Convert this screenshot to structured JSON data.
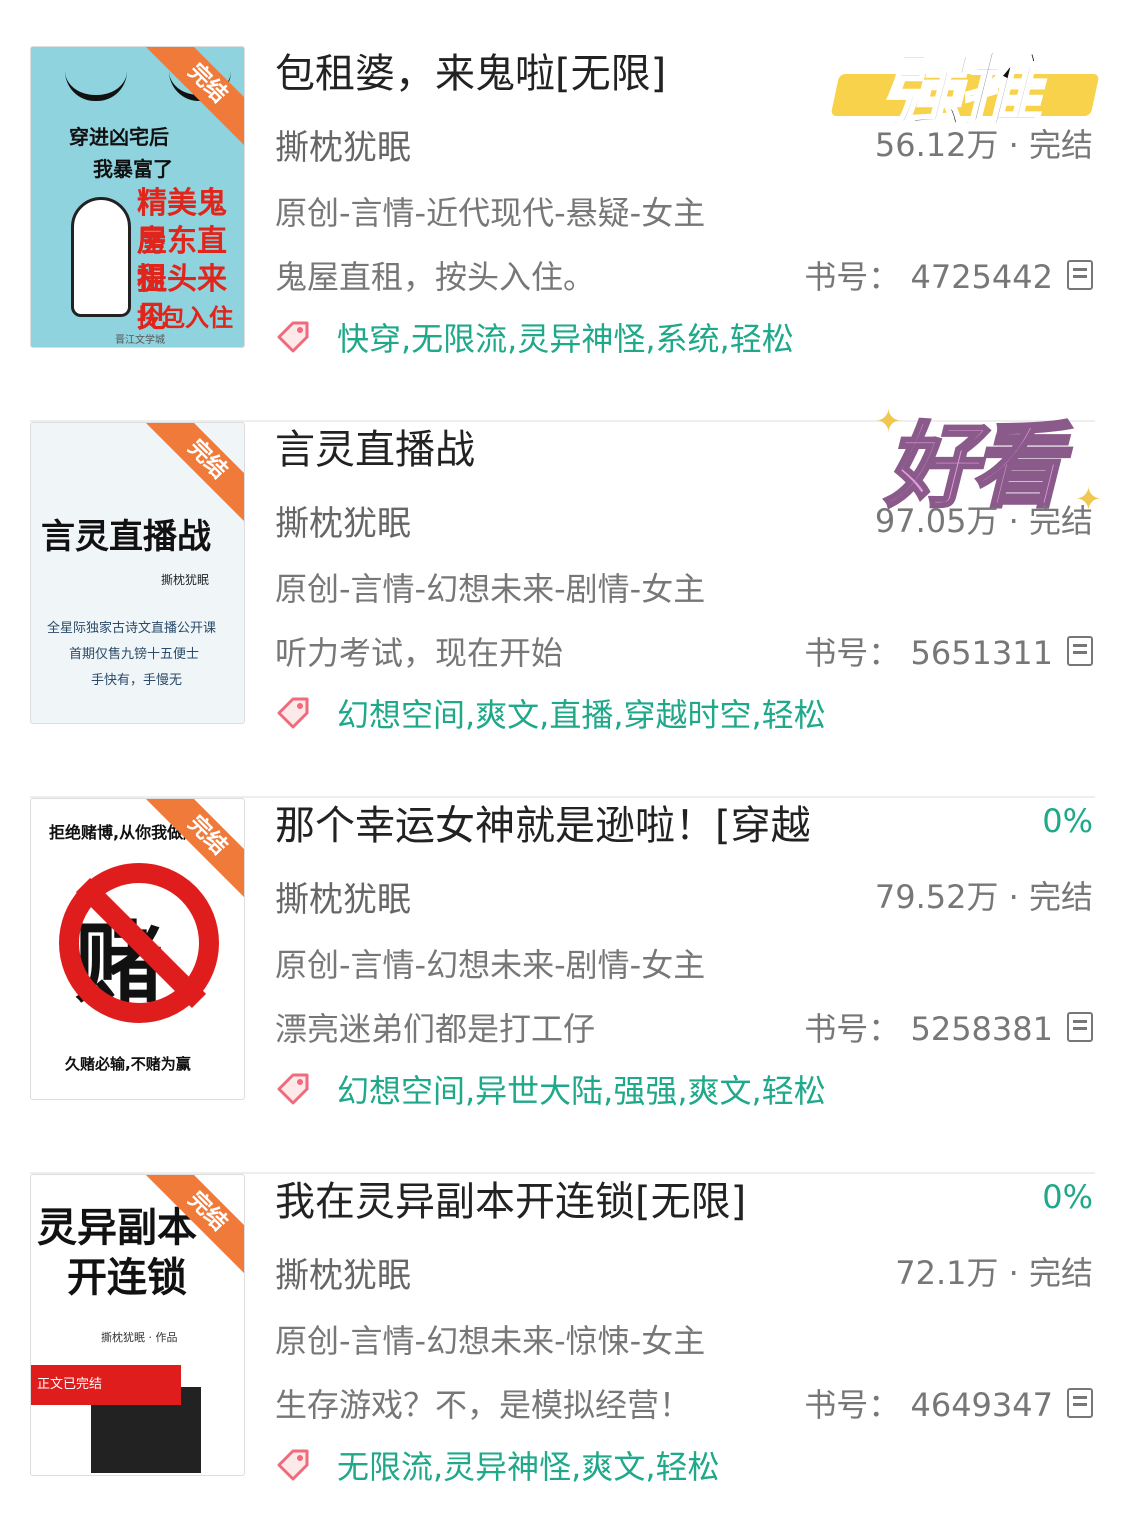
{
  "books": [
    {
      "title": "包租婆，来鬼啦[无限]",
      "author": "撕枕犹眠",
      "stat": "56.12万 · 完结",
      "genre": "原创-言情-近代现代-悬疑-女主",
      "intro": "鬼屋直租，按头入住。",
      "book_id": "书号： 4725442",
      "tags": "快穿,无限流,灵异神怪,系统,轻松",
      "ribbon": "完结",
      "stamp": "强推",
      "cover_text": {
        "line1": "穿进凶宅后",
        "line2": "我暴富了",
        "red1": "精美鬼屋",
        "red2": "房东直租",
        "red3": "提头来见",
        "red4": "拎包入住",
        "brand": "晋江文学城"
      }
    },
    {
      "title": "言灵直播战",
      "author": "撕枕犹眠",
      "stat": "97.05万 · 完结",
      "genre": "原创-言情-幻想未来-剧情-女主",
      "intro": "听力考试，现在开始",
      "book_id": "书号： 5651311",
      "tags": "幻想空间,爽文,直播,穿越时空,轻松",
      "ribbon": "完结",
      "stamp": "好看",
      "cover_text": {
        "big": "言灵直播战",
        "author": "撕枕犹眠",
        "line1": "全星际独家古诗文直播公开课",
        "line2": "首期仅售九镑十五便士",
        "line3": "手快有，手慢无"
      }
    },
    {
      "title": "那个幸运女神就是逊啦！[穿越",
      "author": "撕枕犹眠",
      "stat": "79.52万 · 完结",
      "genre": "原创-言情-幻想未来-剧情-女主",
      "intro": "漂亮迷弟们都是打工仔",
      "book_id": "书号： 5258381",
      "tags": "幻想空间,异世大陆,强强,爽文,轻松",
      "progress": "0%",
      "ribbon": "完结",
      "cover_text": {
        "head": "拒绝赌博,从你我做起",
        "big": "赌",
        "foot": "久赌必输,不赌为赢"
      }
    },
    {
      "title": "我在灵异副本开连锁[无限]",
      "author": "撕枕犹眠",
      "stat": "72.1万 · 完结",
      "genre": "原创-言情-幻想未来-惊悚-女主",
      "intro": "生存游戏？不，是模拟经营！",
      "book_id": "书号： 4649347",
      "tags": "无限流,灵异神怪,爽文,轻松",
      "progress": "0%",
      "ribbon": "完结",
      "cover_text": {
        "big1": "灵异副本",
        "big2": "开连锁",
        "by": "撕枕犹眠 · 作品",
        "banner": "正文已完结"
      }
    }
  ],
  "colors": {
    "tag_green": "#1fa88a",
    "ribbon_orange": "#f07a3a",
    "stamp_yellow": "#f8d24a",
    "stamp_pink": "#e59be0"
  }
}
